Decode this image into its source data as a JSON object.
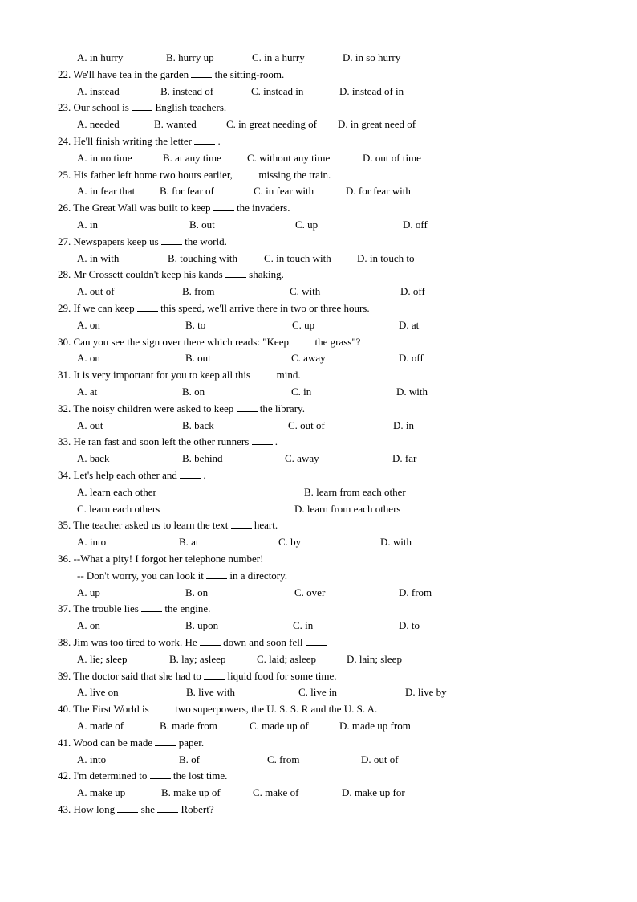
{
  "document": {
    "orphan_options": [
      "A. in hurry",
      "B. hurry up",
      "C. in a hurry",
      "D. in so hurry"
    ],
    "questions": [
      {
        "number": "22.",
        "parts": [
          "We'll have tea in the garden ",
          "",
          " the sitting-room."
        ],
        "options": [
          "A. instead",
          "B. instead of",
          "C. instead in",
          "D. instead of in"
        ]
      },
      {
        "number": "23.",
        "parts": [
          "Our school is ",
          "",
          " English teachers."
        ],
        "options": [
          "A. needed",
          "B. wanted",
          "C. in great needing of",
          "D. in great need of"
        ]
      },
      {
        "number": "24.",
        "parts": [
          "He'll finish writing the letter ",
          "",
          " ."
        ],
        "options": [
          "A. in no time",
          "B. at any time",
          "C. without any time",
          "D. out of time"
        ]
      },
      {
        "number": "25.",
        "parts": [
          "His father left home two hours earlier, ",
          "",
          " missing the train."
        ],
        "options": [
          "A. in fear that",
          "B. for fear of",
          "C. in fear with",
          "D. for fear with"
        ]
      },
      {
        "number": "26.",
        "parts": [
          "The Great Wall was built to keep ",
          "",
          " the invaders."
        ],
        "options": [
          "A. in",
          "B. out",
          "C. up",
          "D. off"
        ]
      },
      {
        "number": "27.",
        "parts": [
          "Newspapers keep us ",
          "",
          " the world."
        ],
        "options": [
          "A. in with",
          "B. touching with",
          "C. in touch with",
          "D. in touch to"
        ]
      },
      {
        "number": "28.",
        "parts": [
          "Mr Crossett couldn't keep his kands ",
          "",
          " shaking."
        ],
        "options": [
          "A. out of",
          "B. from",
          "C. with",
          "D. off"
        ]
      },
      {
        "number": "29.",
        "parts": [
          "If we can keep ",
          "",
          " this speed, we'll arrive there in two or three hours."
        ],
        "options": [
          "A. on",
          "B. to",
          "C. up",
          "D. at"
        ]
      },
      {
        "number": "30.",
        "parts": [
          "Can you see the sign over there which reads: \"Keep ",
          "",
          " the grass\"?"
        ],
        "options": [
          "A. on",
          "B. out",
          "C. away",
          "D. off"
        ]
      },
      {
        "number": "31.",
        "parts": [
          "It is very important for you to keep all this ",
          "",
          " mind."
        ],
        "options": [
          "A. at",
          "B. on",
          "C. in",
          "D. with"
        ]
      },
      {
        "number": "32.",
        "parts": [
          "The noisy children were asked to keep ",
          "",
          " the library."
        ],
        "options": [
          "A. out",
          "B. back",
          "C. out of",
          "D. in"
        ]
      },
      {
        "number": "33.",
        "parts": [
          "He ran fast and soon left the other runners ",
          "",
          " ."
        ],
        "options": [
          "A. back",
          "B. behind",
          "C. away",
          "D. far"
        ]
      },
      {
        "number": "34.",
        "parts": [
          "Let's help each other and ",
          "",
          " ."
        ],
        "options": [
          "A. learn each other",
          "B. learn from each other",
          "C. learn each others",
          "D. learn from each others"
        ]
      },
      {
        "number": "35.",
        "parts": [
          "The teacher asked us to learn the text ",
          "",
          " heart."
        ],
        "options": [
          "A. into",
          "B. at",
          "C. by",
          "D. with"
        ]
      },
      {
        "number": "36.",
        "parts": [
          "--What a pity! I forgot her telephone number!"
        ],
        "continuation": [
          "-- Don't worry, you can look it ",
          "",
          " in a directory."
        ],
        "options": [
          "A. up",
          "B. on",
          "C. over",
          "D. from"
        ]
      },
      {
        "number": "37.",
        "parts": [
          "The trouble lies ",
          "",
          " the engine."
        ],
        "options": [
          "A. on",
          "B. upon",
          "C. in",
          "D. to"
        ]
      },
      {
        "number": "38.",
        "parts": [
          "Jim was too tired to work. He ",
          "",
          " down and soon fell ",
          ""
        ],
        "options": [
          "A. lie; sleep",
          "B. lay; asleep",
          "C. laid; asleep",
          "D. lain; sleep"
        ]
      },
      {
        "number": "39.",
        "parts": [
          "The doctor said that she had to ",
          "",
          " liquid food for some time."
        ],
        "options": [
          "A. live on",
          "B. live with",
          "C. live in",
          "D. live by"
        ]
      },
      {
        "number": "40.",
        "parts": [
          "The First World is ",
          "",
          " two superpowers, the U. S. S. R and the U. S. A."
        ],
        "options": [
          "A. made of",
          "B. made from",
          "C. made up of",
          "D. made up from"
        ]
      },
      {
        "number": "41.",
        "parts": [
          "Wood can be made ",
          "",
          " paper."
        ],
        "options": [
          "A. into",
          "B. of",
          "C. from",
          "D. out of"
        ]
      },
      {
        "number": "42.",
        "parts": [
          "I'm determined to ",
          "",
          " the lost time."
        ],
        "options": [
          "A. make up",
          "B. make up of",
          "C. make of",
          "D. make up for"
        ]
      },
      {
        "number": "43.",
        "parts": [
          "How long ",
          "",
          " she ",
          "",
          " Robert?"
        ]
      }
    ]
  }
}
